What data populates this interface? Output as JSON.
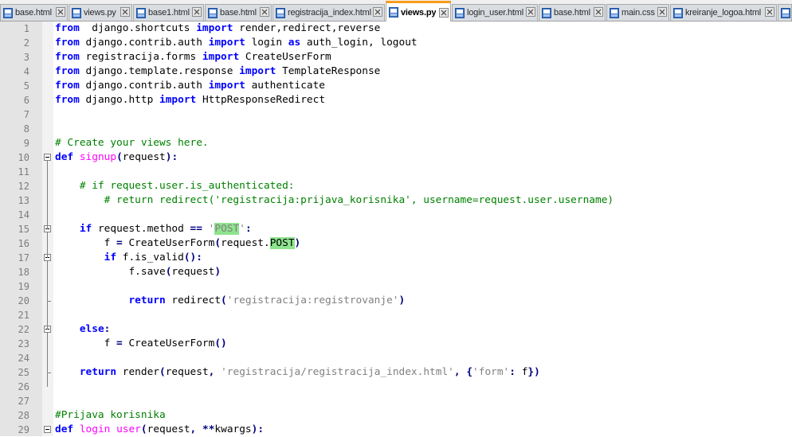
{
  "tabs": [
    {
      "label": "base.html",
      "active": false
    },
    {
      "label": "views.py",
      "active": false
    },
    {
      "label": "base1.html",
      "active": false
    },
    {
      "label": "base.html",
      "active": false
    },
    {
      "label": "registracija_index.html",
      "active": false
    },
    {
      "label": "views.py",
      "active": true
    },
    {
      "label": "login_user.html",
      "active": false
    },
    {
      "label": "base.html",
      "active": false
    },
    {
      "label": "main.css",
      "active": false
    },
    {
      "label": "kreiranje_logoa.html",
      "active": false
    },
    {
      "label": "",
      "active": false
    }
  ],
  "icons": {
    "tab_file": "file-icon",
    "tab_close": "close-icon",
    "fold_open": "fold-minus-icon"
  },
  "colors": {
    "keyword": "#0000ff",
    "function_name": "#ff00ff",
    "comment": "#008000",
    "string": "#808080",
    "operator": "#000080",
    "highlight": "#8ee38e",
    "active_tab_accent": "#fa9d1a"
  },
  "editor": {
    "lines": [
      {
        "num": "1",
        "tokens": [
          [
            "kw",
            "from"
          ],
          [
            "",
            "  django.shortcuts "
          ],
          [
            "kw",
            "import"
          ],
          [
            "",
            " render,redirect,reverse"
          ]
        ]
      },
      {
        "num": "2",
        "tokens": [
          [
            "kw",
            "from"
          ],
          [
            "",
            " django.contrib.auth "
          ],
          [
            "kw",
            "import"
          ],
          [
            "",
            " login "
          ],
          [
            "kw",
            "as"
          ],
          [
            "",
            " auth_login, logout"
          ]
        ]
      },
      {
        "num": "3",
        "tokens": [
          [
            "kw",
            "from"
          ],
          [
            "",
            " registracija.forms "
          ],
          [
            "kw",
            "import"
          ],
          [
            "",
            " CreateUserForm"
          ]
        ]
      },
      {
        "num": "4",
        "tokens": [
          [
            "kw",
            "from"
          ],
          [
            "",
            " django.template.response "
          ],
          [
            "kw",
            "import"
          ],
          [
            "",
            " TemplateResponse"
          ]
        ]
      },
      {
        "num": "5",
        "tokens": [
          [
            "kw",
            "from"
          ],
          [
            "",
            " django.contrib.auth "
          ],
          [
            "kw",
            "import"
          ],
          [
            "",
            " authenticate"
          ]
        ]
      },
      {
        "num": "6",
        "tokens": [
          [
            "kw",
            "from"
          ],
          [
            "",
            " django.http "
          ],
          [
            "kw",
            "import"
          ],
          [
            "",
            " HttpResponseRedirect"
          ]
        ]
      },
      {
        "num": "7",
        "tokens": []
      },
      {
        "num": "8",
        "tokens": []
      },
      {
        "num": "9",
        "tokens": [
          [
            "cm",
            "# Create your views here."
          ]
        ]
      },
      {
        "num": "10",
        "tokens": [
          [
            "kw",
            "def"
          ],
          [
            "",
            " "
          ],
          [
            "fn",
            "signup"
          ],
          [
            "op",
            "("
          ],
          [
            "",
            "request"
          ],
          [
            "op",
            "):"
          ]
        ]
      },
      {
        "num": "11",
        "tokens": []
      },
      {
        "num": "12",
        "tokens": [
          [
            "",
            "    "
          ],
          [
            "cm",
            "# if request.user.is_authenticated:"
          ]
        ]
      },
      {
        "num": "13",
        "tokens": [
          [
            "",
            "        "
          ],
          [
            "cm",
            "# return redirect('registracija:prijava_korisnika', username=request.user.username)"
          ]
        ]
      },
      {
        "num": "14",
        "tokens": []
      },
      {
        "num": "15",
        "tokens": [
          [
            "",
            "    "
          ],
          [
            "kw",
            "if"
          ],
          [
            "",
            " request.method "
          ],
          [
            "op",
            "=="
          ],
          [
            "",
            " "
          ],
          [
            "st",
            "'"
          ],
          [
            "hl st",
            "POST"
          ],
          [
            "st",
            "'"
          ],
          [
            "op",
            ":"
          ]
        ]
      },
      {
        "num": "16",
        "tokens": [
          [
            "",
            "        f "
          ],
          [
            "op",
            "="
          ],
          [
            "",
            " CreateUserForm"
          ],
          [
            "op",
            "("
          ],
          [
            "",
            "request."
          ],
          [
            "hl",
            "POST"
          ],
          [
            "op",
            ")"
          ]
        ]
      },
      {
        "num": "17",
        "tokens": [
          [
            "",
            "        "
          ],
          [
            "kw",
            "if"
          ],
          [
            "",
            " f.is_valid"
          ],
          [
            "op",
            "():"
          ]
        ]
      },
      {
        "num": "18",
        "tokens": [
          [
            "",
            "            f.save"
          ],
          [
            "op",
            "("
          ],
          [
            "",
            "request"
          ],
          [
            "op",
            ")"
          ]
        ]
      },
      {
        "num": "19",
        "tokens": []
      },
      {
        "num": "20",
        "tokens": [
          [
            "",
            "            "
          ],
          [
            "kw",
            "return"
          ],
          [
            "",
            " redirect"
          ],
          [
            "op",
            "("
          ],
          [
            "st",
            "'registracija:registrovanje'"
          ],
          [
            "op",
            ")"
          ]
        ]
      },
      {
        "num": "21",
        "tokens": []
      },
      {
        "num": "22",
        "tokens": [
          [
            "",
            "    "
          ],
          [
            "kw",
            "else"
          ],
          [
            "op",
            ":"
          ]
        ]
      },
      {
        "num": "23",
        "tokens": [
          [
            "",
            "        f "
          ],
          [
            "op",
            "="
          ],
          [
            "",
            " CreateUserForm"
          ],
          [
            "op",
            "()"
          ]
        ]
      },
      {
        "num": "24",
        "tokens": []
      },
      {
        "num": "25",
        "tokens": [
          [
            "",
            "    "
          ],
          [
            "kw",
            "return"
          ],
          [
            "",
            " render"
          ],
          [
            "op",
            "("
          ],
          [
            "",
            "request"
          ],
          [
            "op",
            ","
          ],
          [
            "",
            " "
          ],
          [
            "st",
            "'registracija/registracija_index.html'"
          ],
          [
            "op",
            ","
          ],
          [
            "",
            " "
          ],
          [
            "op",
            "{"
          ],
          [
            "st",
            "'form'"
          ],
          [
            "op",
            ":"
          ],
          [
            "",
            " f"
          ],
          [
            "op",
            "})"
          ]
        ]
      },
      {
        "num": "26",
        "tokens": []
      },
      {
        "num": "27",
        "tokens": []
      },
      {
        "num": "28",
        "tokens": [
          [
            "cm",
            "#Prijava korisnika"
          ]
        ]
      },
      {
        "num": "29",
        "tokens": [
          [
            "kw",
            "def"
          ],
          [
            "",
            " "
          ],
          [
            "fn",
            "login user"
          ],
          [
            "op",
            "("
          ],
          [
            "",
            "request"
          ],
          [
            "op",
            ","
          ],
          [
            "",
            " "
          ],
          [
            "op",
            "**"
          ],
          [
            "",
            "kwargs"
          ],
          [
            "op",
            "):"
          ]
        ]
      }
    ]
  }
}
